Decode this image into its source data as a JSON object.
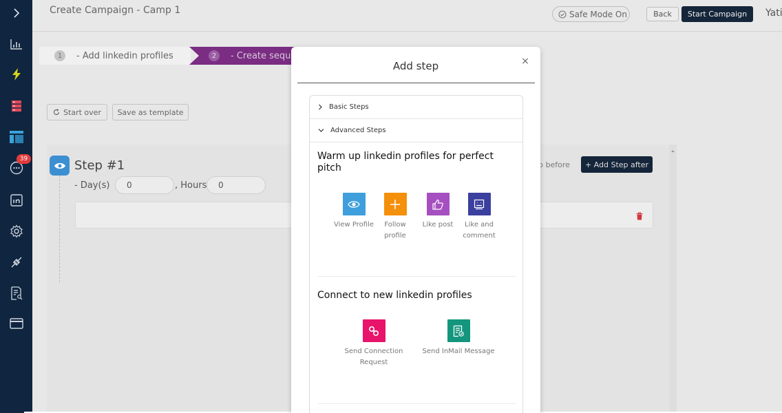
{
  "sidebar": {
    "badge_count": "39",
    "items": [
      {
        "name": "expand-icon"
      },
      {
        "name": "analytics-icon"
      },
      {
        "name": "lightning-icon"
      },
      {
        "name": "database-icon"
      },
      {
        "name": "layout-icon"
      },
      {
        "name": "chat-icon"
      },
      {
        "name": "linkedin-icon"
      },
      {
        "name": "settings-icon"
      },
      {
        "name": "integration-icon"
      },
      {
        "name": "report-icon"
      },
      {
        "name": "billing-icon"
      }
    ]
  },
  "header": {
    "title": "Create Campaign - Camp 1",
    "safe_mode": "Safe Mode On",
    "back": "Back",
    "start_campaign": "Start Campaign",
    "user_partial": "Yati"
  },
  "stepper": [
    {
      "num": "1",
      "label": "- Add linkedin profiles"
    },
    {
      "num": "2",
      "label": "- Create sequ"
    }
  ],
  "toolbar": {
    "start_over": "Start over",
    "save_template": "Save as template"
  },
  "step": {
    "title": "Step #1",
    "days_label": "- Day(s)",
    "days_value": "0",
    "hours_label": ", Hours",
    "hours_value": "0",
    "add_before_partial": "p before",
    "add_after": "+ Add Step after"
  },
  "modal": {
    "title": "Add step",
    "close": "×",
    "basic_steps": "Basic Steps",
    "advanced_steps": "Advanced Steps",
    "warmup_title": "Warm up linkedin profiles for perfect pitch",
    "warmup_items": [
      {
        "label": "View Profile",
        "color": "#3f9fdc"
      },
      {
        "label": "Follow profile",
        "color": "#f4900c"
      },
      {
        "label": "Like post",
        "color": "#a64fc1"
      },
      {
        "label": "Like and comment",
        "color": "#3b3f9e"
      }
    ],
    "connect_title": "Connect to new linkedin profiles",
    "connect_items": [
      {
        "label": "Send Connection Request",
        "color": "#e8136a"
      },
      {
        "label": "Send InMail Message",
        "color": "#14957e"
      }
    ]
  },
  "colors": {
    "sidebar_bg": "#0f2540",
    "primary_dark": "#15253a",
    "stepper_active": "#7a2d82"
  }
}
